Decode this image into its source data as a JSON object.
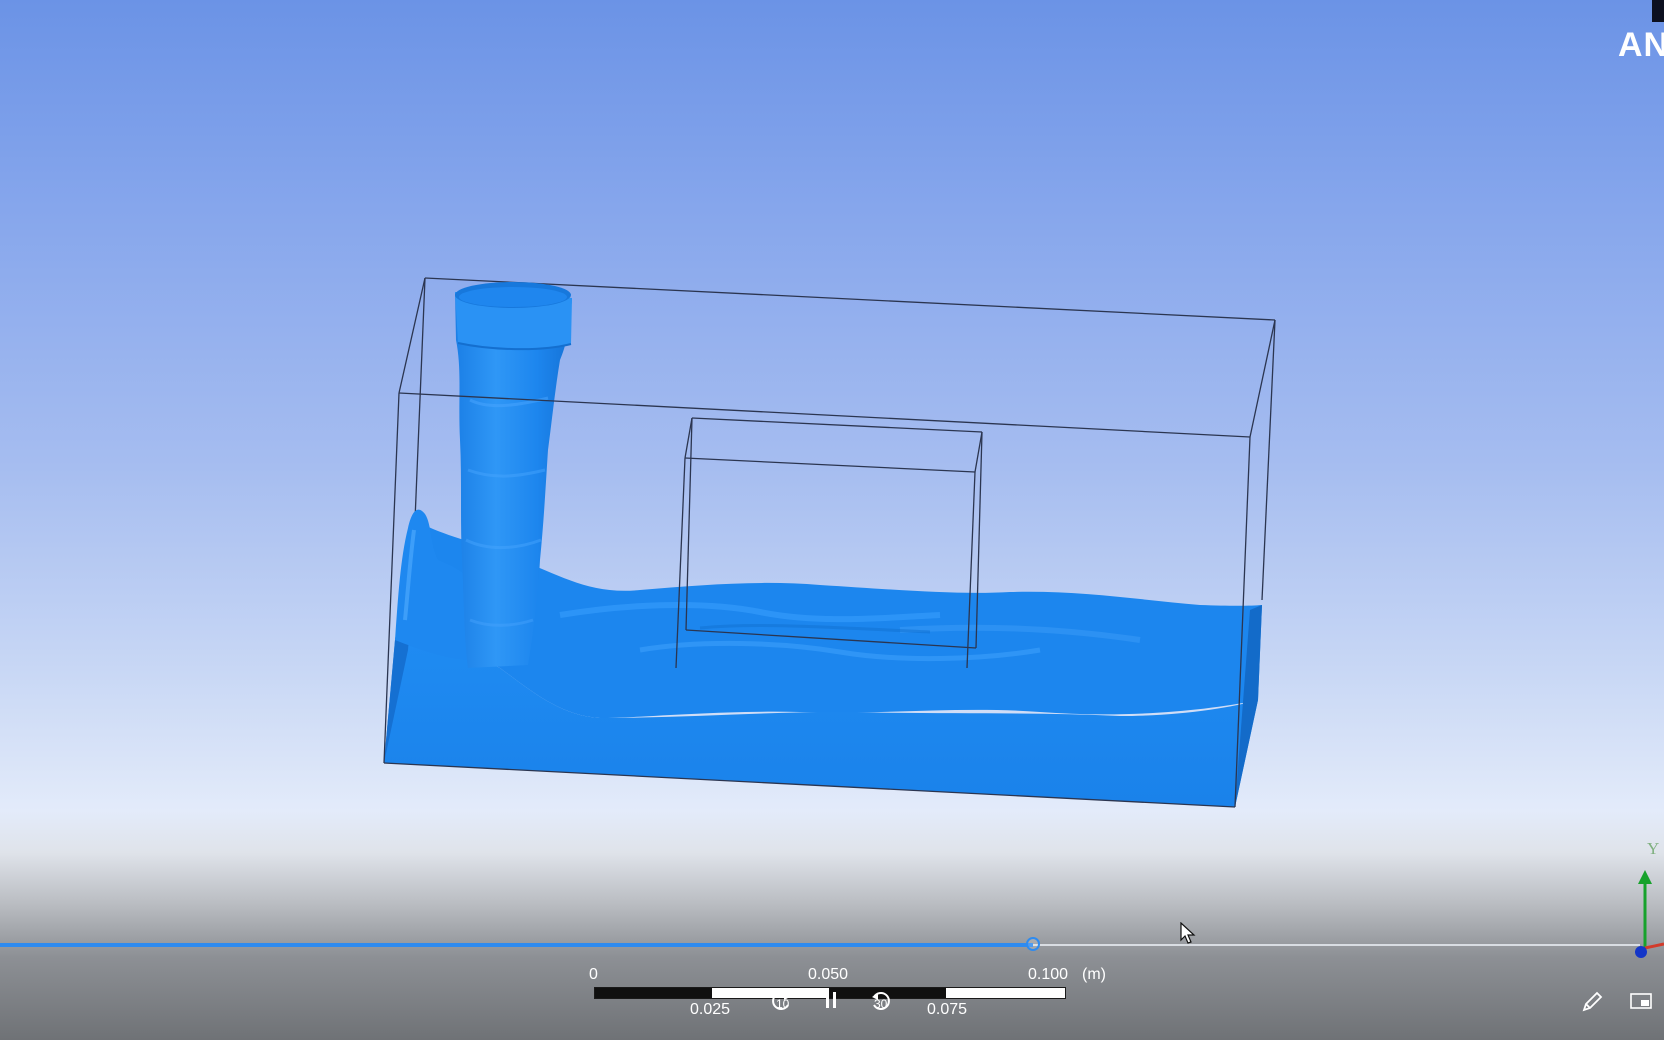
{
  "viewer": {
    "logo_text": "AN",
    "colors": {
      "fluid": "#1e88f0",
      "timeline": "#2e8bf0",
      "axis_y": "#17a22c",
      "axis_x": "#d23b2b",
      "axis_z": "#1436c8"
    }
  },
  "playback": {
    "progress": 0.63,
    "rewind_label": "10",
    "forward_label": "30",
    "pause_icon": "pause-icon"
  },
  "scale_bar": {
    "top_labels": [
      "0",
      "0.050",
      "0.100"
    ],
    "bottom_labels": [
      "0.025",
      "0.075"
    ],
    "unit": "(m)"
  },
  "axes": {
    "y_label": "Y"
  },
  "icons": {
    "edit": "pencil-icon",
    "window": "window-icon",
    "cursor": "mouse-cursor-icon"
  }
}
